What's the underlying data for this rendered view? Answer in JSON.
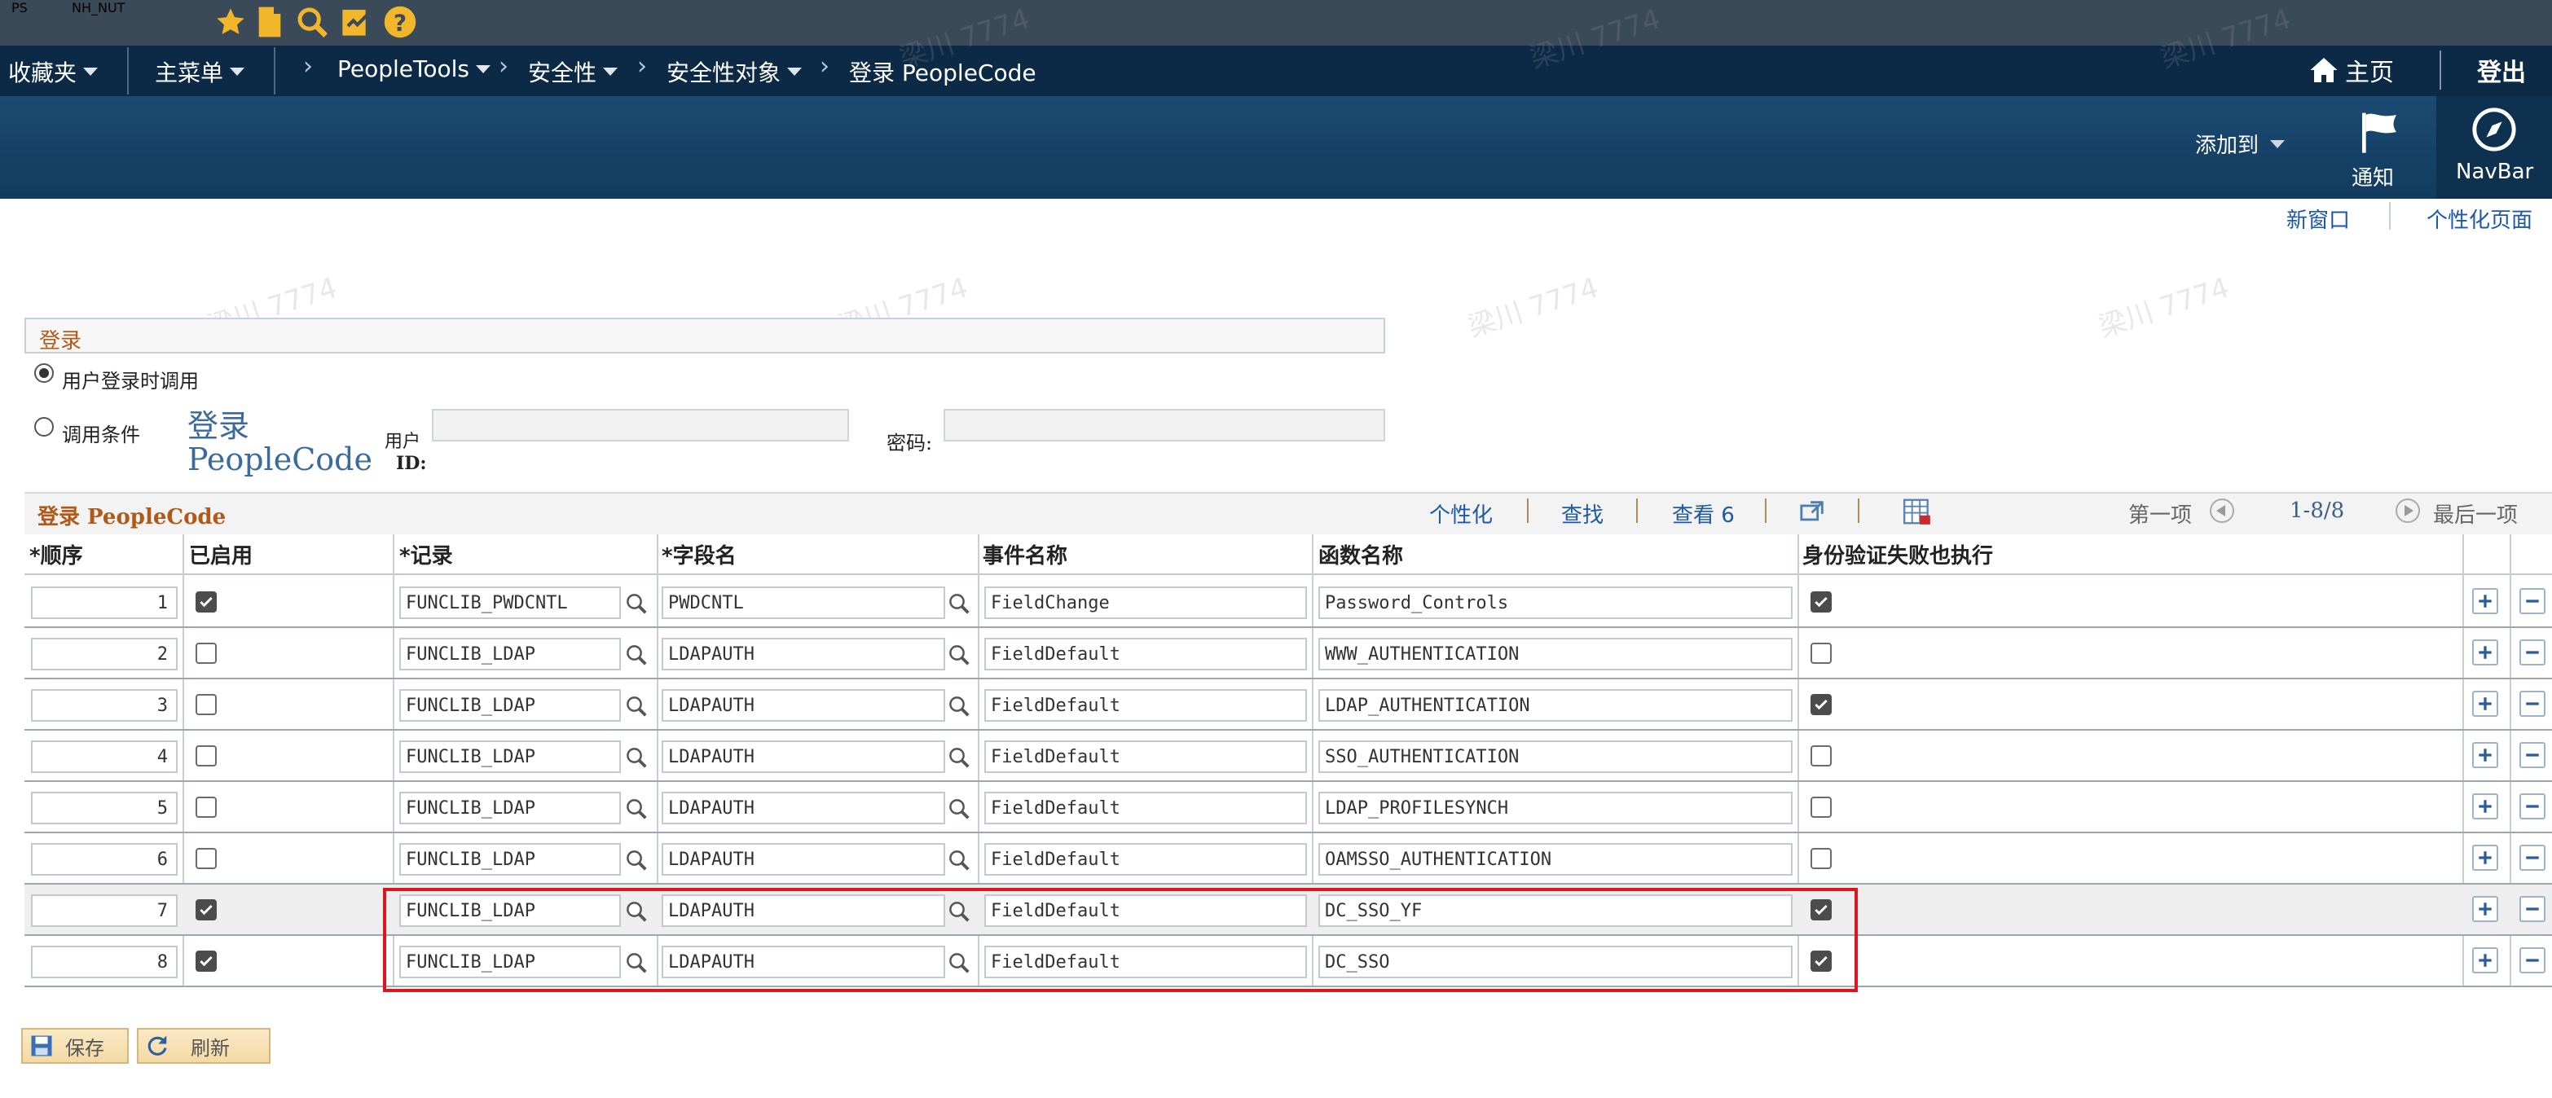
{
  "topbar": {
    "app": "PS",
    "db": "NH_NUT"
  },
  "nav": {
    "favorites": "收藏夹",
    "main_menu": "主菜单",
    "crumb1": "PeopleTools",
    "crumb2": "安全性",
    "crumb3": "安全性对象",
    "crumb4": "登录 PeopleCode",
    "home": "主页",
    "logout": "登出"
  },
  "header": {
    "add_to": "添加到",
    "notify": "通知",
    "navbar": "NavBar"
  },
  "links": {
    "new_window": "新窗口",
    "personalize_page": "个性化页面"
  },
  "section": {
    "title": "登录"
  },
  "radio1": "用户登录时调用",
  "radio2": "调用条件",
  "login_pc_line1": "登录",
  "login_pc_line2": "PeopleCode",
  "user_label1": "用户",
  "user_label2": "ID:",
  "password_label": "密码:",
  "grid": {
    "title": "登录 PeopleCode",
    "personalize": "个性化",
    "find": "查找",
    "view": "查看 6",
    "first": "第一项",
    "range": "1-8/8",
    "last": "最后一项",
    "columns": [
      "*顺序",
      "已启用",
      "*记录",
      "*字段名",
      "事件名称",
      "函数名称",
      "身份验证失败也执行"
    ],
    "rows": [
      {
        "seq": "1",
        "enabled": true,
        "record": "FUNCLIB_PWDCNTL",
        "field": "PWDCNTL",
        "event": "FieldChange",
        "func": "Password_Controls",
        "exec": true
      },
      {
        "seq": "2",
        "enabled": false,
        "record": "FUNCLIB_LDAP",
        "field": "LDAPAUTH",
        "event": "FieldDefault",
        "func": "WWW_AUTHENTICATION",
        "exec": false
      },
      {
        "seq": "3",
        "enabled": false,
        "record": "FUNCLIB_LDAP",
        "field": "LDAPAUTH",
        "event": "FieldDefault",
        "func": "LDAP_AUTHENTICATION",
        "exec": true
      },
      {
        "seq": "4",
        "enabled": false,
        "record": "FUNCLIB_LDAP",
        "field": "LDAPAUTH",
        "event": "FieldDefault",
        "func": "SSO_AUTHENTICATION",
        "exec": false
      },
      {
        "seq": "5",
        "enabled": false,
        "record": "FUNCLIB_LDAP",
        "field": "LDAPAUTH",
        "event": "FieldDefault",
        "func": "LDAP_PROFILESYNCH",
        "exec": false
      },
      {
        "seq": "6",
        "enabled": false,
        "record": "FUNCLIB_LDAP",
        "field": "LDAPAUTH",
        "event": "FieldDefault",
        "func": "OAMSSO_AUTHENTICATION",
        "exec": false
      },
      {
        "seq": "7",
        "enabled": true,
        "record": "FUNCLIB_LDAP",
        "field": "LDAPAUTH",
        "event": "FieldDefault",
        "func": "DC_SSO_YF",
        "exec": true
      },
      {
        "seq": "8",
        "enabled": true,
        "record": "FUNCLIB_LDAP",
        "field": "LDAPAUTH",
        "event": "FieldDefault",
        "func": "DC_SSO",
        "exec": true
      }
    ]
  },
  "buttons": {
    "save": "保存",
    "refresh": "刷新"
  },
  "watermark": "梁川 7774",
  "colors": {
    "nav": "#0c2a46",
    "accent": "#1d5aa3",
    "highlight": "#e0151b",
    "topbar_text": "#f2b62b"
  }
}
